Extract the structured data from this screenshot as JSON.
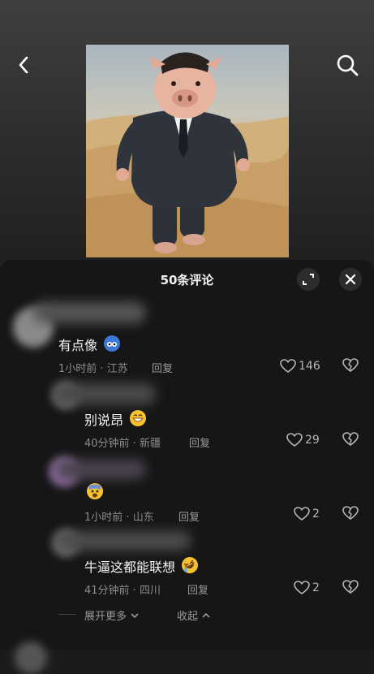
{
  "header": {
    "back_icon": "chevron-left-icon",
    "search_icon": "search-icon"
  },
  "video": {
    "description_visible": false
  },
  "comments_sheet": {
    "title": "50条评论",
    "expand_icon": "expand-icon",
    "close_icon": "close-icon"
  },
  "comments": [
    {
      "text": "有点像",
      "emoji": "blue-face-emoji",
      "time": "1小时前",
      "location": "江苏",
      "reply_label": "回复",
      "likes": "146"
    },
    {
      "text": "别说昂",
      "emoji": "grin-emoji",
      "time": "40分钟前",
      "location": "新疆",
      "reply_label": "回复",
      "likes": "29"
    },
    {
      "text": "",
      "emoji": "fearful-emoji",
      "time": "1小时前",
      "location": "山东",
      "reply_label": "回复",
      "likes": "2"
    },
    {
      "text": "牛逼这都能联想",
      "emoji": "rofl-emoji",
      "time": "41分钟前",
      "location": "四川",
      "reply_label": "回复",
      "likes": "2"
    }
  ],
  "footer": {
    "show_more": "展开更多",
    "collapse": "收起"
  },
  "colors": {
    "sheet_bg": "#161616",
    "text_muted": "#8c8c8c"
  }
}
